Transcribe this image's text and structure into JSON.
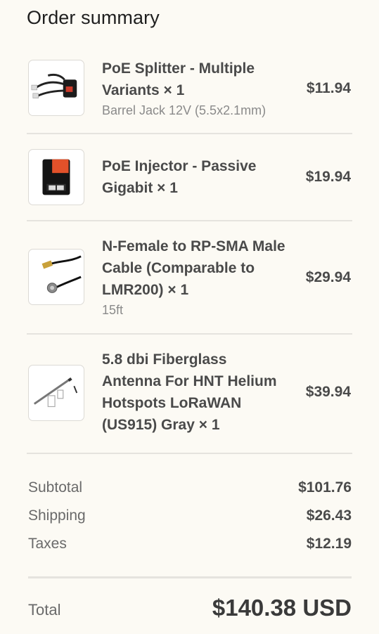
{
  "header": {
    "title": "Order summary"
  },
  "items": [
    {
      "name": "PoE Splitter - Multiple Variants × 1",
      "variant": "Barrel Jack 12V (5.5x2.1mm)",
      "price": "$11.94",
      "thumbnail": "poe-splitter-image"
    },
    {
      "name": "PoE Injector - Passive Gigabit × 1",
      "variant": "",
      "price": "$19.94",
      "thumbnail": "poe-injector-image"
    },
    {
      "name": "N-Female to RP-SMA Male Cable (Comparable to LMR200) × 1",
      "variant": "15ft",
      "price": "$29.94",
      "thumbnail": "cable-image"
    },
    {
      "name": "5.8 dbi Fiberglass Antenna For HNT Helium Hotspots LoRaWAN (US915) Gray × 1",
      "variant": "",
      "price": "$39.94",
      "thumbnail": "antenna-image"
    }
  ],
  "totals": {
    "subtotal_label": "Subtotal",
    "subtotal": "$101.76",
    "shipping_label": "Shipping",
    "shipping": "$26.43",
    "taxes_label": "Taxes",
    "taxes": "$12.19",
    "total_label": "Total",
    "total": "$140.38 USD"
  },
  "colors": {
    "background": "#fcfaf4",
    "text": "#4a4a4a",
    "muted": "#8a8a8a",
    "divider": "#e5e3de",
    "injector_accent": "#e2512a"
  }
}
